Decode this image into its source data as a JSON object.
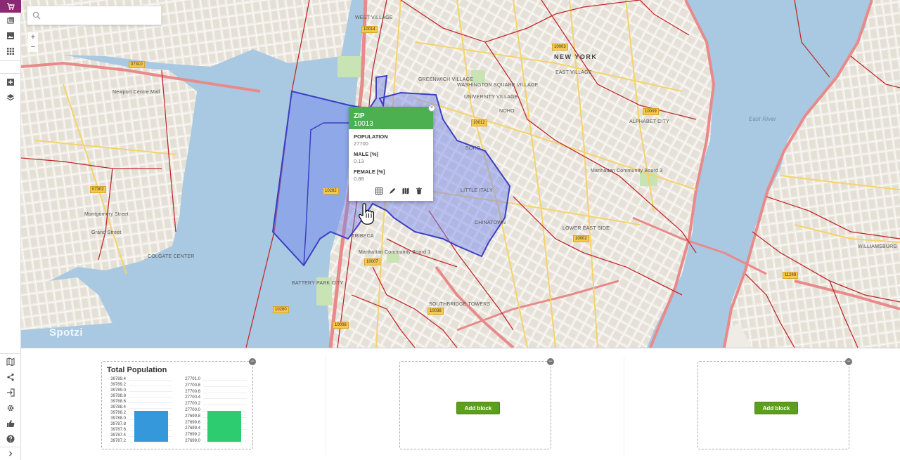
{
  "sidebar": {
    "items": [
      {
        "name": "cart-icon",
        "active": true
      },
      {
        "name": "layers-data-icon"
      },
      {
        "name": "image-icon"
      },
      {
        "name": "grid-icon"
      },
      {
        "name": "select-area-icon"
      },
      {
        "name": "layers-icon"
      },
      {
        "name": "map-icon"
      },
      {
        "name": "share-icon"
      },
      {
        "name": "login-icon"
      },
      {
        "name": "settings-icon"
      },
      {
        "name": "thumbs-up-icon"
      },
      {
        "name": "help-icon"
      },
      {
        "name": "expand-icon"
      }
    ],
    "accent": "#8b2a73"
  },
  "search": {
    "placeholder": "",
    "value": ""
  },
  "zoom": {
    "in_label": "+",
    "out_label": "−"
  },
  "map": {
    "watermark": "Spotzi",
    "labels": [
      {
        "text": "NEW YORK",
        "kind": "big"
      },
      {
        "text": "EAST VILLAGE",
        "kind": "place"
      },
      {
        "text": "WEST VILLAGE",
        "kind": "place"
      },
      {
        "text": "GREENWICH VILLAGE",
        "kind": "place"
      },
      {
        "text": "WASHINGTON SQUARE VILLAGE",
        "kind": "place"
      },
      {
        "text": "UNIVERSITY VILLAGE",
        "kind": "place"
      },
      {
        "text": "NOHO",
        "kind": "place"
      },
      {
        "text": "SOHO",
        "kind": "place"
      },
      {
        "text": "LITTLE ITALY",
        "kind": "place"
      },
      {
        "text": "CHINATOWN",
        "kind": "place"
      },
      {
        "text": "TRIBECA",
        "kind": "place"
      },
      {
        "text": "ALPHABET CITY",
        "kind": "place"
      },
      {
        "text": "LOWER EAST SIDE",
        "kind": "place"
      },
      {
        "text": "BATTERY PARK CITY",
        "kind": "place"
      },
      {
        "text": "WILLIAMSBURG",
        "kind": "place"
      },
      {
        "text": "East River",
        "kind": "water"
      },
      {
        "text": "Manhattan Community Board 3",
        "kind": "place"
      },
      {
        "text": "Manhattan Community Board 1",
        "kind": "place"
      },
      {
        "text": "Newport Centre Mall",
        "kind": "place"
      },
      {
        "text": "COLGATE CENTER",
        "kind": "place"
      },
      {
        "text": "SOUTHBRIDGE TOWERS",
        "kind": "place"
      },
      {
        "text": "Grand Street",
        "kind": "place"
      },
      {
        "text": "Montgomery Street",
        "kind": "place"
      }
    ],
    "zip_tags": [
      "10014",
      "07310",
      "10003",
      "10009",
      "10012",
      "10282",
      "07302",
      "10002",
      "10007",
      "10280",
      "10038",
      "10006",
      "11249"
    ]
  },
  "popup": {
    "title": "ZIP",
    "zip": "10013",
    "close": "×",
    "fields": [
      {
        "label": "POPULATION",
        "value": "27700"
      },
      {
        "label": "MALE [%]",
        "value": "0.13"
      },
      {
        "label": "FEMALE [%]",
        "value": "0.88"
      }
    ],
    "actions": [
      "table-icon",
      "edit-icon",
      "map-icon",
      "delete-icon"
    ]
  },
  "panel": {
    "chart_block": {
      "remove": "−"
    },
    "empty_blocks": [
      {
        "button": "Add block",
        "remove": "−"
      },
      {
        "button": "Add block",
        "remove": "−"
      }
    ]
  },
  "chart_data": {
    "type": "bar",
    "title": "Total Population",
    "left_axis_ticks": [
      "39789.4",
      "39789.2",
      "39789.0",
      "39788.8",
      "39788.6",
      "39788.4",
      "39788.2",
      "39788.0",
      "39787.8",
      "39787.6",
      "39787.4",
      "39787.2"
    ],
    "right_axis_ticks": [
      "27701.0",
      "27700.8",
      "27700.6",
      "27700.4",
      "27700.2",
      "27700.0",
      "27699.8",
      "27699.6",
      "27699.4",
      "27699.2",
      "27699.0"
    ],
    "series": [
      {
        "value": 39788.3,
        "color": "#3498db",
        "axis": "left",
        "ylim": [
          39787.2,
          39789.4
        ]
      },
      {
        "value": 27700.0,
        "color": "#2ecc71",
        "axis": "right",
        "ylim": [
          27699.0,
          27701.0
        ]
      }
    ],
    "grid": true
  }
}
